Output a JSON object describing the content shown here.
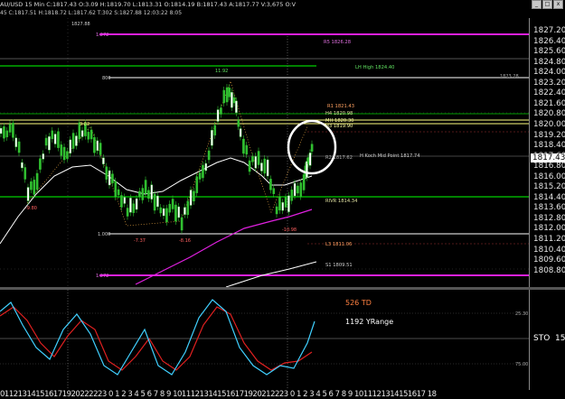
{
  "header": {
    "symbol_line": "AU/USD  15 Min  C:1817.43  O:3.09  H:1819.70  L:1813.31  O:1814.19  B:1817.43  A:1817.77  V:3,675  O:V",
    "info_line": "45  C:1817.51  H:1818.72  L:1817.62  T:302  S:1827.88  12:03:22  8:05",
    "window_buttons": [
      "_",
      "□",
      "x"
    ]
  },
  "price_axis": {
    "labels": [
      "1827.20",
      "1826.40",
      "1825.60",
      "1824.80",
      "1824.00",
      "1823.20",
      "1822.40",
      "1821.60",
      "1820.80",
      "1820.00",
      "1819.20",
      "1818.40",
      "1817.60",
      "1816.80",
      "1816.00",
      "1815.20",
      "1814.40",
      "1813.60",
      "1812.80",
      "1812.00",
      "1811.20",
      "1810.40",
      "1809.60",
      "1808.80"
    ],
    "current_price": "1817.43"
  },
  "levels": {
    "r5": "R5 1826.28",
    "lh_high": "LH High 1824.40",
    "r1": "R1 1821.43",
    "h4": "H4 1820.98",
    "mh": "MH 1820.30",
    "h3": "H3 1819.90",
    "mid": "H Koch Mid Point 1817.74",
    "r2": "R2 1817.62",
    "rivr": "RIVR 1814.34",
    "l3": "L3 1811.06",
    "s1": "S1 1809.51",
    "fib_272_top": "1.272",
    "fib_800": "800",
    "fib_1000": "1.000",
    "fib_272_bot": "1.272",
    "swing_high": "11.92",
    "swing_left": "9.82",
    "swing_low1": "-7.37",
    "swing_low2": "-8.16",
    "swing_low3": "-10.98",
    "left_low": "-9.80",
    "top_right_small": "1823.28",
    "vline_label": "1827.88"
  },
  "indicator": {
    "td": "526 TD",
    "yrange": "1192 YRange",
    "sto_label": "STO",
    "sto_value": "15.",
    "level_high": "25.30",
    "level_low": "75.00"
  },
  "x_axis": {
    "labels": "011213141516171920222223 0 1 2 3 4 5 6 7 8 9 10111213141516171920212223 0 1 2 3 4 5 6 7 8 9 1011121314151617 18"
  },
  "colors": {
    "magenta": "#e020e0",
    "green": "#00d000",
    "yellow": "#ffff80",
    "candle": "#30c030"
  }
}
